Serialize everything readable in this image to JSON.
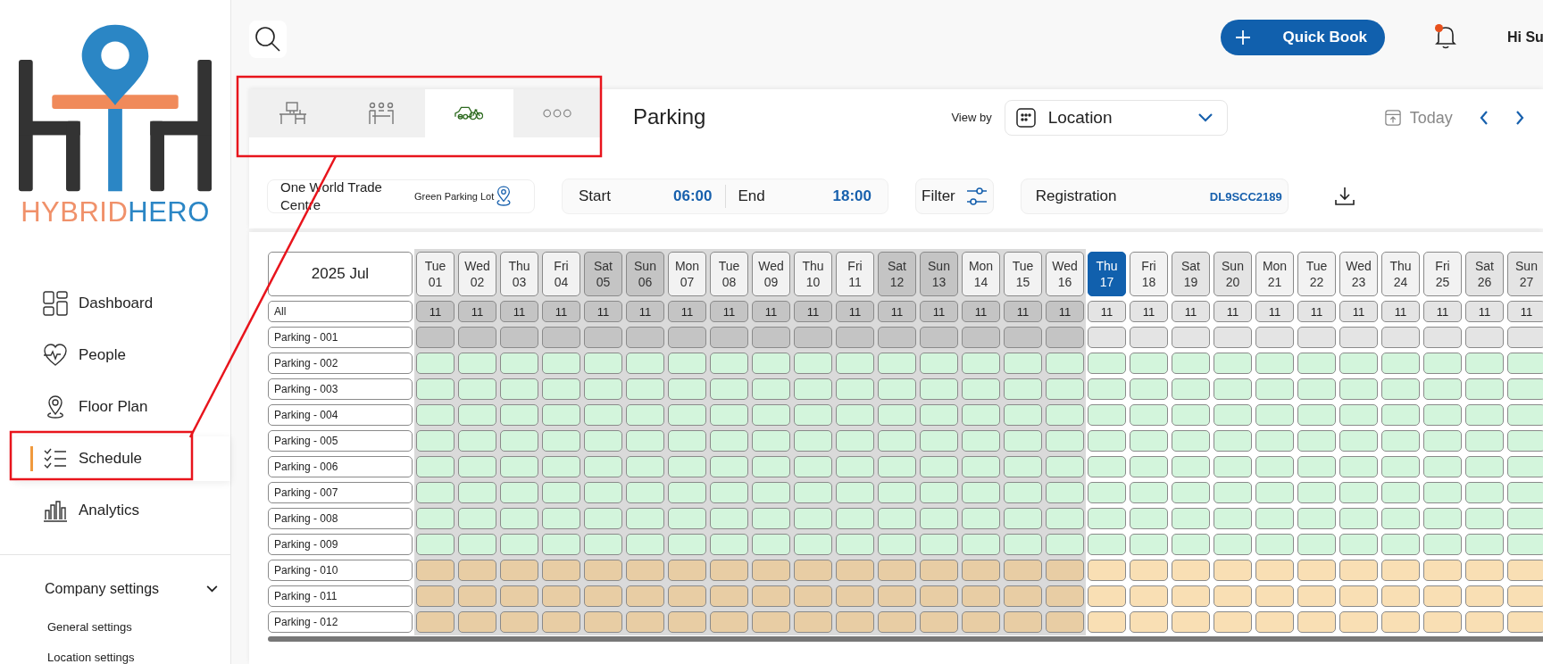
{
  "logo": {
    "text_left": "HYBRID",
    "text_right": "HERO"
  },
  "nav": [
    {
      "label": "Dashboard",
      "kind": "dashboard",
      "selected": false
    },
    {
      "label": "People",
      "kind": "people",
      "selected": false
    },
    {
      "label": "Floor Plan",
      "kind": "pin",
      "selected": false
    },
    {
      "label": "Schedule",
      "kind": "schedule",
      "selected": true
    },
    {
      "label": "Analytics",
      "kind": "analytics",
      "selected": false
    }
  ],
  "settings": {
    "label": "Company settings",
    "expanded": true,
    "items": [
      "General settings",
      "Location settings"
    ]
  },
  "header": {
    "quick_book": "Quick Book",
    "notification": true,
    "greeting": "Hi Su"
  },
  "tabs": [
    {
      "kind": "desk",
      "selected": false
    },
    {
      "kind": "meeting",
      "selected": false
    },
    {
      "kind": "vehicle",
      "selected": true
    },
    {
      "kind": "more",
      "selected": false
    }
  ],
  "title": "Parking",
  "view_by": {
    "label": "View by",
    "value": "Location"
  },
  "today": "Today",
  "location": {
    "building": "One World Trade Centre",
    "lot": "Green Parking Lot"
  },
  "time": {
    "start_label": "Start",
    "start": "06:00",
    "end_label": "End",
    "end": "18:00"
  },
  "filter": "Filter",
  "registration": {
    "label": "Registration",
    "value": "DL9SCC2189"
  },
  "month": "2025 Jul",
  "all_label": "All",
  "days": [
    {
      "weekday": "Tue",
      "date": "01",
      "count": "11",
      "weekend": false,
      "past": true,
      "selected": false
    },
    {
      "weekday": "Wed",
      "date": "02",
      "count": "11",
      "weekend": false,
      "past": true,
      "selected": false
    },
    {
      "weekday": "Thu",
      "date": "03",
      "count": "11",
      "weekend": false,
      "past": true,
      "selected": false
    },
    {
      "weekday": "Fri",
      "date": "04",
      "count": "11",
      "weekend": false,
      "past": true,
      "selected": false
    },
    {
      "weekday": "Sat",
      "date": "05",
      "count": "11",
      "weekend": true,
      "past": true,
      "selected": false
    },
    {
      "weekday": "Sun",
      "date": "06",
      "count": "11",
      "weekend": true,
      "past": true,
      "selected": false
    },
    {
      "weekday": "Mon",
      "date": "07",
      "count": "11",
      "weekend": false,
      "past": true,
      "selected": false
    },
    {
      "weekday": "Tue",
      "date": "08",
      "count": "11",
      "weekend": false,
      "past": true,
      "selected": false
    },
    {
      "weekday": "Wed",
      "date": "09",
      "count": "11",
      "weekend": false,
      "past": true,
      "selected": false
    },
    {
      "weekday": "Thu",
      "date": "10",
      "count": "11",
      "weekend": false,
      "past": true,
      "selected": false
    },
    {
      "weekday": "Fri",
      "date": "11",
      "count": "11",
      "weekend": false,
      "past": true,
      "selected": false
    },
    {
      "weekday": "Sat",
      "date": "12",
      "count": "11",
      "weekend": true,
      "past": true,
      "selected": false
    },
    {
      "weekday": "Sun",
      "date": "13",
      "count": "11",
      "weekend": true,
      "past": true,
      "selected": false
    },
    {
      "weekday": "Mon",
      "date": "14",
      "count": "11",
      "weekend": false,
      "past": true,
      "selected": false
    },
    {
      "weekday": "Tue",
      "date": "15",
      "count": "11",
      "weekend": false,
      "past": true,
      "selected": false
    },
    {
      "weekday": "Wed",
      "date": "16",
      "count": "11",
      "weekend": false,
      "past": true,
      "selected": false
    },
    {
      "weekday": "Thu",
      "date": "17",
      "count": "11",
      "weekend": false,
      "past": false,
      "selected": true
    },
    {
      "weekday": "Fri",
      "date": "18",
      "count": "11",
      "weekend": false,
      "past": false,
      "selected": false
    },
    {
      "weekday": "Sat",
      "date": "19",
      "count": "11",
      "weekend": true,
      "past": false,
      "selected": false
    },
    {
      "weekday": "Sun",
      "date": "20",
      "count": "11",
      "weekend": true,
      "past": false,
      "selected": false
    },
    {
      "weekday": "Mon",
      "date": "21",
      "count": "11",
      "weekend": false,
      "past": false,
      "selected": false
    },
    {
      "weekday": "Tue",
      "date": "22",
      "count": "11",
      "weekend": false,
      "past": false,
      "selected": false
    },
    {
      "weekday": "Wed",
      "date": "23",
      "count": "11",
      "weekend": false,
      "past": false,
      "selected": false
    },
    {
      "weekday": "Thu",
      "date": "24",
      "count": "11",
      "weekend": false,
      "past": false,
      "selected": false
    },
    {
      "weekday": "Fri",
      "date": "25",
      "count": "11",
      "weekend": false,
      "past": false,
      "selected": false
    },
    {
      "weekday": "Sat",
      "date": "26",
      "count": "11",
      "weekend": true,
      "past": false,
      "selected": false
    },
    {
      "weekday": "Sun",
      "date": "27",
      "count": "11",
      "weekend": true,
      "past": false,
      "selected": false
    }
  ],
  "spots": [
    {
      "label": "Parking - 001",
      "kind": "blocked"
    },
    {
      "label": "Parking - 002",
      "kind": "available"
    },
    {
      "label": "Parking - 003",
      "kind": "available"
    },
    {
      "label": "Parking - 004",
      "kind": "available"
    },
    {
      "label": "Parking - 005",
      "kind": "available"
    },
    {
      "label": "Parking - 006",
      "kind": "available"
    },
    {
      "label": "Parking - 007",
      "kind": "available"
    },
    {
      "label": "Parking - 008",
      "kind": "available"
    },
    {
      "label": "Parking - 009",
      "kind": "available"
    },
    {
      "label": "Parking - 010",
      "kind": "reserved"
    },
    {
      "label": "Parking - 011",
      "kind": "reserved"
    },
    {
      "label": "Parking - 012",
      "kind": "reserved"
    }
  ]
}
